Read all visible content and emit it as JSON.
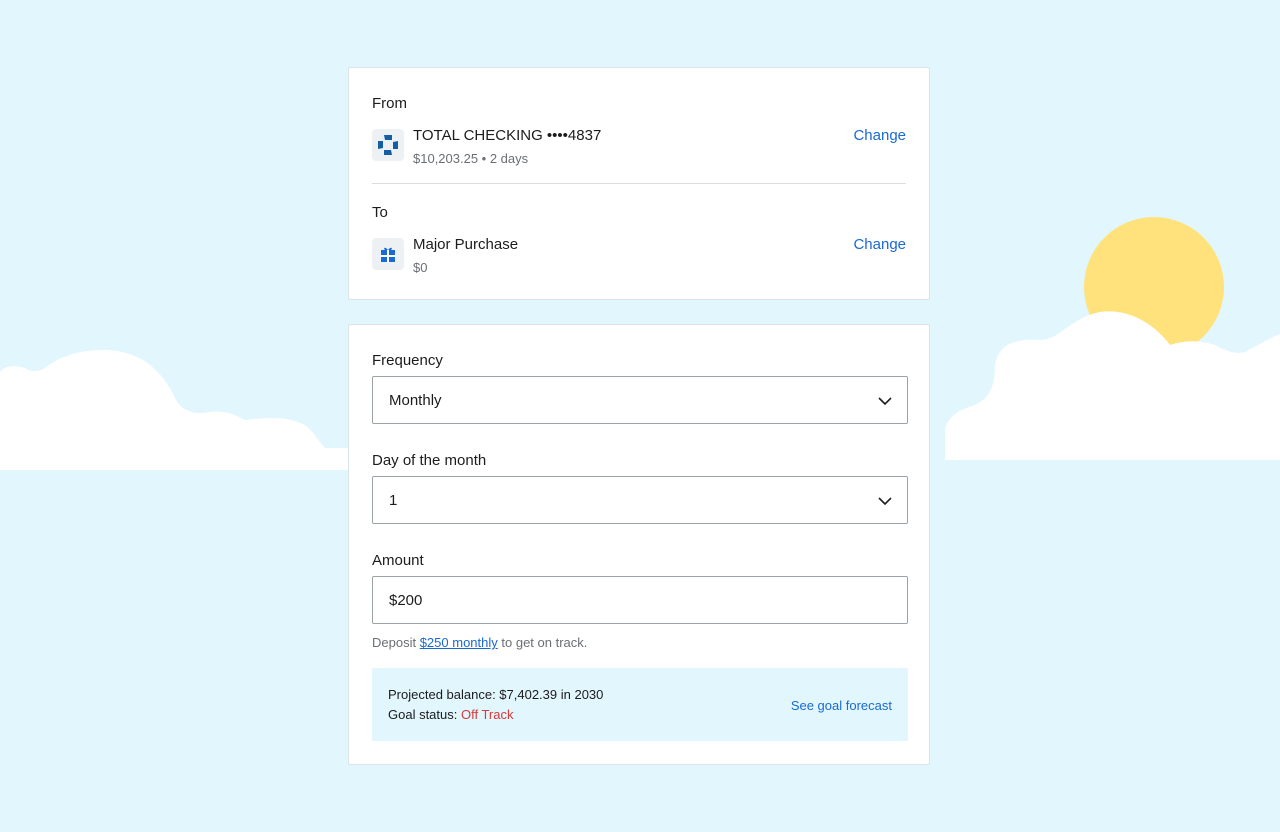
{
  "from": {
    "label": "From",
    "account_name": "TOTAL CHECKING ••••4837",
    "account_detail": "$10,203.25 • 2 days",
    "change_label": "Change",
    "icon": "chase-bank-icon"
  },
  "to": {
    "label": "To",
    "account_name": "Major Purchase",
    "account_detail": "$0",
    "change_label": "Change",
    "icon": "gift-icon"
  },
  "frequency": {
    "label": "Frequency",
    "value": "Monthly"
  },
  "day_of_month": {
    "label": "Day of the month",
    "value": "1"
  },
  "amount": {
    "label": "Amount",
    "value": "$200"
  },
  "hint": {
    "prefix": "Deposit",
    "link": "$250 monthly",
    "suffix": "to get on track."
  },
  "forecast": {
    "projected": "Projected balance: $7,402.39 in 2030",
    "status_label": "Goal status:",
    "status_value": "Off Track",
    "link": "See goal forecast"
  },
  "colors": {
    "background": "#e1f6fd",
    "link": "#1a6ad4",
    "off_track": "#d93a3a",
    "sun": "#ffe27c",
    "chase_blue": "#135fa6"
  }
}
